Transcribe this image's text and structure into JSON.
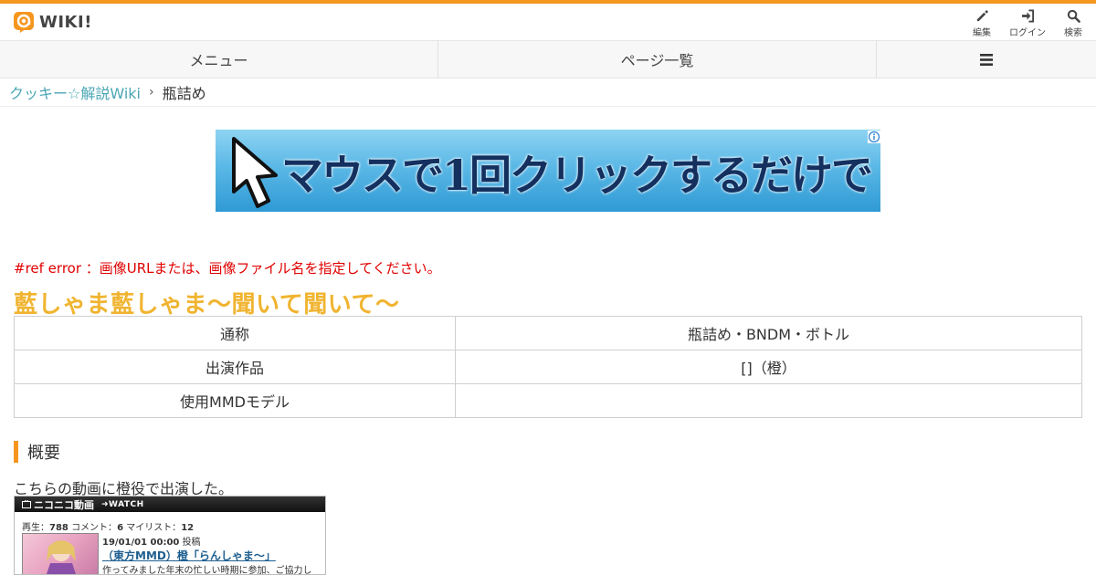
{
  "header": {
    "logo_text": "WIKI",
    "logo_exclaim": "!",
    "buttons": [
      {
        "icon": "pencil-icon",
        "label": "編集"
      },
      {
        "icon": "login-icon",
        "label": "ログイン"
      },
      {
        "icon": "search-icon",
        "label": "検索"
      }
    ]
  },
  "nav": {
    "menu_label": "メニュー",
    "pages_label": "ページ一覧",
    "hamburger_icon": "hamburger-menu-icon"
  },
  "breadcrumb": {
    "home": "クッキー☆解説Wiki",
    "separator": "›",
    "current": "瓶詰め"
  },
  "banner": {
    "text": "マウスで1回クリックするだけで",
    "ad_icon": "adchoices-icon"
  },
  "content": {
    "ref_error": "#ref error ：画像URLまたは、画像ファイル名を指定してください。",
    "page_heading": "藍しゃま藍しゃま～聞いて聞いて～",
    "info_table": [
      {
        "key": "通称",
        "value": "瓶詰め・BNDM・ボトル"
      },
      {
        "key": "出演作品",
        "value": "[]（橙）"
      },
      {
        "key": "使用MMDモデル",
        "value": ""
      }
    ],
    "section_title": "概要",
    "paragraph": "こちらの動画に橙役で出演した。"
  },
  "nico_embed": {
    "brand": "ニコニコ動画",
    "watch": "WATCH",
    "views_label": "再生：",
    "views": "788",
    "comments_label": "コメント：",
    "comments": "6",
    "mylist_label": "マイリスト：",
    "mylist": "12",
    "date": "19/01/01 00:00",
    "posted_label": "投稿",
    "title": "（東方MMD）橙「らんしゃま～」",
    "description": "作ってみました年末の忙しい時期に参加、ご協力し"
  },
  "colors": {
    "accent": "#f5961e",
    "link": "#4aa6b4",
    "heading": "#f0b430",
    "error": "#e00000"
  }
}
